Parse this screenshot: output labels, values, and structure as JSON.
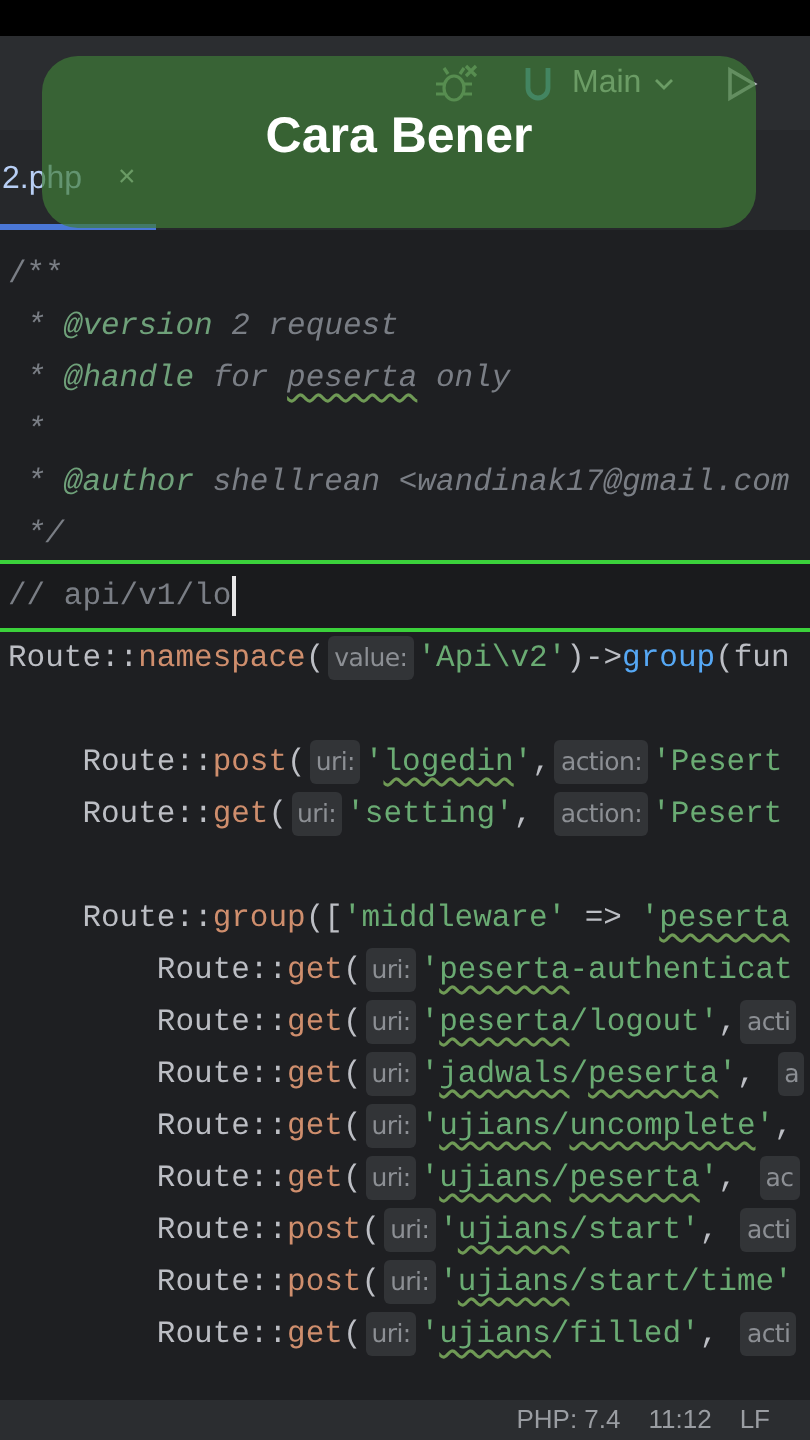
{
  "toolbar": {
    "branch": "Main"
  },
  "tabs": [
    {
      "label": "2.php",
      "close": "×",
      "selected": true
    }
  ],
  "overlay": {
    "caption": "Cara Bener"
  },
  "editor": {
    "lines": [
      {
        "selected": false,
        "segments": [
          {
            "kind": "comment",
            "text": "/**"
          }
        ]
      },
      {
        "selected": false,
        "segments": [
          {
            "kind": "doc",
            "text": " * "
          },
          {
            "kind": "doctag",
            "text": "@version"
          },
          {
            "kind": "doc",
            "text": " 2 request"
          }
        ]
      },
      {
        "selected": false,
        "segments": [
          {
            "kind": "doc",
            "text": " * "
          },
          {
            "kind": "doctag",
            "text": "@handle"
          },
          {
            "kind": "doc",
            "text": " for "
          },
          {
            "kind": "doc-typo",
            "text": "peserta"
          },
          {
            "kind": "doc",
            "text": " only"
          }
        ]
      },
      {
        "selected": false,
        "segments": [
          {
            "kind": "doc",
            "text": " *"
          }
        ]
      },
      {
        "selected": false,
        "segments": [
          {
            "kind": "doc",
            "text": " * "
          },
          {
            "kind": "doctag",
            "text": "@author"
          },
          {
            "kind": "doc",
            "text": " shellrean <wandinak17@gmail.com"
          }
        ]
      },
      {
        "selected": false,
        "segments": [
          {
            "kind": "doc",
            "text": " */"
          }
        ]
      },
      {
        "selected": true,
        "segments": [
          {
            "kind": "comment",
            "text": "// api/v1/lo"
          }
        ]
      },
      {
        "selected": false,
        "segments": [
          {
            "kind": "text",
            "text": "Route::"
          },
          {
            "kind": "method",
            "text": "namespace"
          },
          {
            "kind": "text",
            "text": "("
          },
          {
            "kind": "hint",
            "text": "value:"
          },
          {
            "kind": "string",
            "text": "'Api\\v2'"
          },
          {
            "kind": "text",
            "text": ")->"
          },
          {
            "kind": "call",
            "text": "group"
          },
          {
            "kind": "text",
            "text": "(fun"
          }
        ]
      },
      {
        "selected": false
      },
      {
        "selected": false,
        "segments": [
          {
            "kind": "text",
            "text": "    Route::"
          },
          {
            "kind": "method",
            "text": "post"
          },
          {
            "kind": "text",
            "text": "("
          },
          {
            "kind": "hint",
            "text": "uri:"
          },
          {
            "kind": "string",
            "text": "'"
          },
          {
            "kind": "string-typo",
            "text": "logedin"
          },
          {
            "kind": "string",
            "text": "'"
          },
          {
            "kind": "text",
            "text": ","
          },
          {
            "kind": "hint",
            "text": "action:"
          },
          {
            "kind": "string",
            "text": "'Pesert"
          }
        ]
      },
      {
        "selected": false,
        "segments": [
          {
            "kind": "text",
            "text": "    Route::"
          },
          {
            "kind": "method",
            "text": "get"
          },
          {
            "kind": "text",
            "text": "("
          },
          {
            "kind": "hint",
            "text": "uri:"
          },
          {
            "kind": "string",
            "text": "'setting'"
          },
          {
            "kind": "text",
            "text": ", "
          },
          {
            "kind": "hint",
            "text": "action:"
          },
          {
            "kind": "string",
            "text": "'Pesert"
          }
        ]
      },
      {
        "selected": false
      },
      {
        "selected": false,
        "segments": [
          {
            "kind": "text",
            "text": "    Route::"
          },
          {
            "kind": "method",
            "text": "group"
          },
          {
            "kind": "text",
            "text": "(["
          },
          {
            "kind": "string",
            "text": "'middleware'"
          },
          {
            "kind": "text",
            "text": " => "
          },
          {
            "kind": "string",
            "text": "'"
          },
          {
            "kind": "string-typo",
            "text": "peserta"
          }
        ]
      },
      {
        "selected": false,
        "segments": [
          {
            "kind": "text",
            "text": "        Route::"
          },
          {
            "kind": "method",
            "text": "get"
          },
          {
            "kind": "text",
            "text": "("
          },
          {
            "kind": "hint",
            "text": "uri:"
          },
          {
            "kind": "string",
            "text": "'"
          },
          {
            "kind": "string-typo",
            "text": "peserta"
          },
          {
            "kind": "string",
            "text": "-authenticat"
          }
        ]
      },
      {
        "selected": false,
        "segments": [
          {
            "kind": "text",
            "text": "        Route::"
          },
          {
            "kind": "method",
            "text": "get"
          },
          {
            "kind": "text",
            "text": "("
          },
          {
            "kind": "hint",
            "text": "uri:"
          },
          {
            "kind": "string",
            "text": "'"
          },
          {
            "kind": "string-typo",
            "text": "peserta"
          },
          {
            "kind": "string",
            "text": "/logout'"
          },
          {
            "kind": "text",
            "text": ","
          },
          {
            "kind": "hint",
            "text": "acti"
          }
        ]
      },
      {
        "selected": false,
        "segments": [
          {
            "kind": "text",
            "text": "        Route::"
          },
          {
            "kind": "method",
            "text": "get"
          },
          {
            "kind": "text",
            "text": "("
          },
          {
            "kind": "hint",
            "text": "uri:"
          },
          {
            "kind": "string",
            "text": "'"
          },
          {
            "kind": "string-typo",
            "text": "jadwals"
          },
          {
            "kind": "string",
            "text": "/"
          },
          {
            "kind": "string-typo",
            "text": "peserta"
          },
          {
            "kind": "string",
            "text": "'"
          },
          {
            "kind": "text",
            "text": ", "
          },
          {
            "kind": "hint",
            "text": "a"
          }
        ]
      },
      {
        "selected": false,
        "segments": [
          {
            "kind": "text",
            "text": "        Route::"
          },
          {
            "kind": "method",
            "text": "get"
          },
          {
            "kind": "text",
            "text": "("
          },
          {
            "kind": "hint",
            "text": "uri:"
          },
          {
            "kind": "string",
            "text": "'"
          },
          {
            "kind": "string-typo",
            "text": "ujians"
          },
          {
            "kind": "string",
            "text": "/"
          },
          {
            "kind": "string-typo",
            "text": "uncomplete"
          },
          {
            "kind": "string",
            "text": "'"
          },
          {
            "kind": "text",
            "text": ","
          }
        ]
      },
      {
        "selected": false,
        "segments": [
          {
            "kind": "text",
            "text": "        Route::"
          },
          {
            "kind": "method",
            "text": "get"
          },
          {
            "kind": "text",
            "text": "("
          },
          {
            "kind": "hint",
            "text": "uri:"
          },
          {
            "kind": "string",
            "text": "'"
          },
          {
            "kind": "string-typo",
            "text": "ujians"
          },
          {
            "kind": "string",
            "text": "/"
          },
          {
            "kind": "string-typo",
            "text": "peserta"
          },
          {
            "kind": "string",
            "text": "'"
          },
          {
            "kind": "text",
            "text": ", "
          },
          {
            "kind": "hint",
            "text": "ac"
          }
        ]
      },
      {
        "selected": false,
        "segments": [
          {
            "kind": "text",
            "text": "        Route::"
          },
          {
            "kind": "method",
            "text": "post"
          },
          {
            "kind": "text",
            "text": "("
          },
          {
            "kind": "hint",
            "text": "uri:"
          },
          {
            "kind": "string",
            "text": "'"
          },
          {
            "kind": "string-typo",
            "text": "ujians"
          },
          {
            "kind": "string",
            "text": "/start'"
          },
          {
            "kind": "text",
            "text": ", "
          },
          {
            "kind": "hint",
            "text": "acti"
          }
        ]
      },
      {
        "selected": false,
        "segments": [
          {
            "kind": "text",
            "text": "        Route::"
          },
          {
            "kind": "method",
            "text": "post"
          },
          {
            "kind": "text",
            "text": "("
          },
          {
            "kind": "hint",
            "text": "uri:"
          },
          {
            "kind": "string",
            "text": "'"
          },
          {
            "kind": "string-typo",
            "text": "ujians"
          },
          {
            "kind": "string",
            "text": "/start/time'"
          }
        ]
      },
      {
        "selected": false,
        "segments": [
          {
            "kind": "text",
            "text": "        Route::"
          },
          {
            "kind": "method",
            "text": "get"
          },
          {
            "kind": "text",
            "text": "("
          },
          {
            "kind": "hint",
            "text": "uri:"
          },
          {
            "kind": "string",
            "text": "'"
          },
          {
            "kind": "string-typo",
            "text": "ujians"
          },
          {
            "kind": "string",
            "text": "/filled'"
          },
          {
            "kind": "text",
            "text": ", "
          },
          {
            "kind": "hint",
            "text": "acti"
          }
        ]
      }
    ]
  },
  "status_bar": {
    "items": [
      "PHP: 7.4",
      "11:12",
      "LF"
    ]
  }
}
